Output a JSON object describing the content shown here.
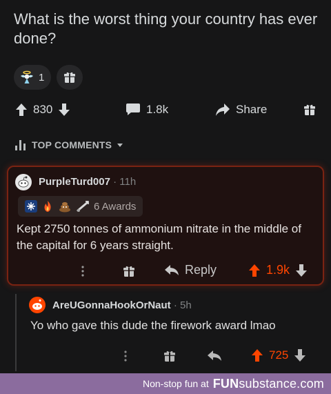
{
  "post": {
    "title": "What is the worst thing your country has ever done?",
    "award_count": "1",
    "upvotes": "830",
    "comments": "1.8k",
    "share_label": "Share"
  },
  "sort": {
    "label": "TOP COMMENTS"
  },
  "comment1": {
    "username": "PurpleTurd007",
    "separator": "·",
    "age": "11h",
    "awards_label": "6 Awards",
    "body": "Kept 2750 tonnes of ammonium nitrate in the middle of the capital for 6 years straight.",
    "reply_label": "Reply",
    "score": "1.9k"
  },
  "comment2": {
    "username": "AreUGonnaHookOrNaut",
    "separator": "·",
    "age": "5h",
    "body": "Yo who gave this dude the firework award lmao",
    "score": "725"
  },
  "footer": {
    "tagline": "Non-stop fun at",
    "brand_prefix": "FUN",
    "brand_suffix": "substance.com"
  },
  "colors": {
    "background": "#161617",
    "upvote_active": "#ff4500",
    "highlight_border": "#7a2312",
    "footer_bg": "#8b6c9e"
  },
  "icons": [
    "angel-award-icon",
    "gift-icon",
    "upvote-icon",
    "downvote-icon",
    "comment-icon",
    "share-icon",
    "sort-icon",
    "chevron-down-icon",
    "more-icon",
    "reply-icon",
    "snoo-avatar-icon"
  ]
}
